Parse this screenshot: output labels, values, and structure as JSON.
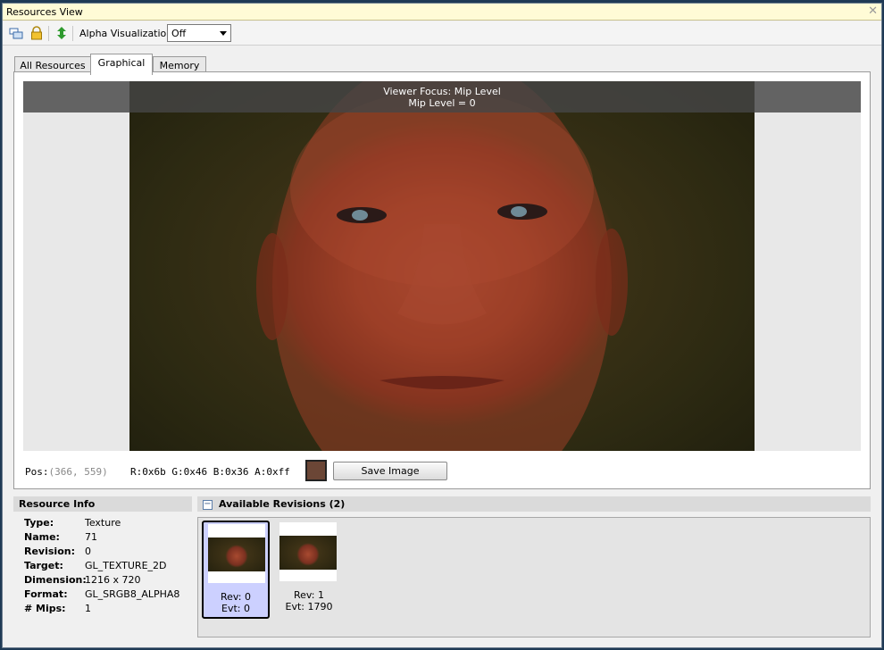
{
  "window": {
    "title": "Resources View"
  },
  "toolbar": {
    "alpha_label": "Alpha Visualization:",
    "alpha_value": "Off",
    "icons": [
      "window-layout-icon",
      "lock-icon",
      "refresh-icon"
    ]
  },
  "tabs": [
    {
      "label": "All Resources",
      "active": false
    },
    {
      "label": "Graphical",
      "active": true
    },
    {
      "label": "Memory",
      "active": false
    }
  ],
  "viewer": {
    "overlay_line1": "Viewer Focus: Mip Level",
    "overlay_line2": "Mip Level = 0",
    "image_subject": "3D rendered bald man face"
  },
  "pixel_info": {
    "pos_label": "Pos:",
    "pos_value": "(366, 559)",
    "rgba": "R:0x6b G:0x46 B:0x36 A:0xff",
    "swatch_color": "#6b4636",
    "save_button": "Save Image"
  },
  "resource_info": {
    "header": "Resource Info",
    "rows": [
      {
        "key": "Type:",
        "value": "Texture"
      },
      {
        "key": "Name:",
        "value": "71"
      },
      {
        "key": "Revision:",
        "value": "0"
      },
      {
        "key": "Target:",
        "value": "GL_TEXTURE_2D"
      },
      {
        "key": "Dimension:",
        "value": "1216 x 720"
      },
      {
        "key": "Format:",
        "value": "GL_SRGB8_ALPHA8"
      },
      {
        "key": "# Mips:",
        "value": "1"
      }
    ]
  },
  "revisions": {
    "header": "Available Revisions (2)",
    "collapse_symbol": "−",
    "items": [
      {
        "rev": "Rev: 0",
        "evt": "Evt: 0",
        "selected": true
      },
      {
        "rev": "Rev: 1",
        "evt": "Evt: 1790",
        "selected": false
      }
    ]
  }
}
